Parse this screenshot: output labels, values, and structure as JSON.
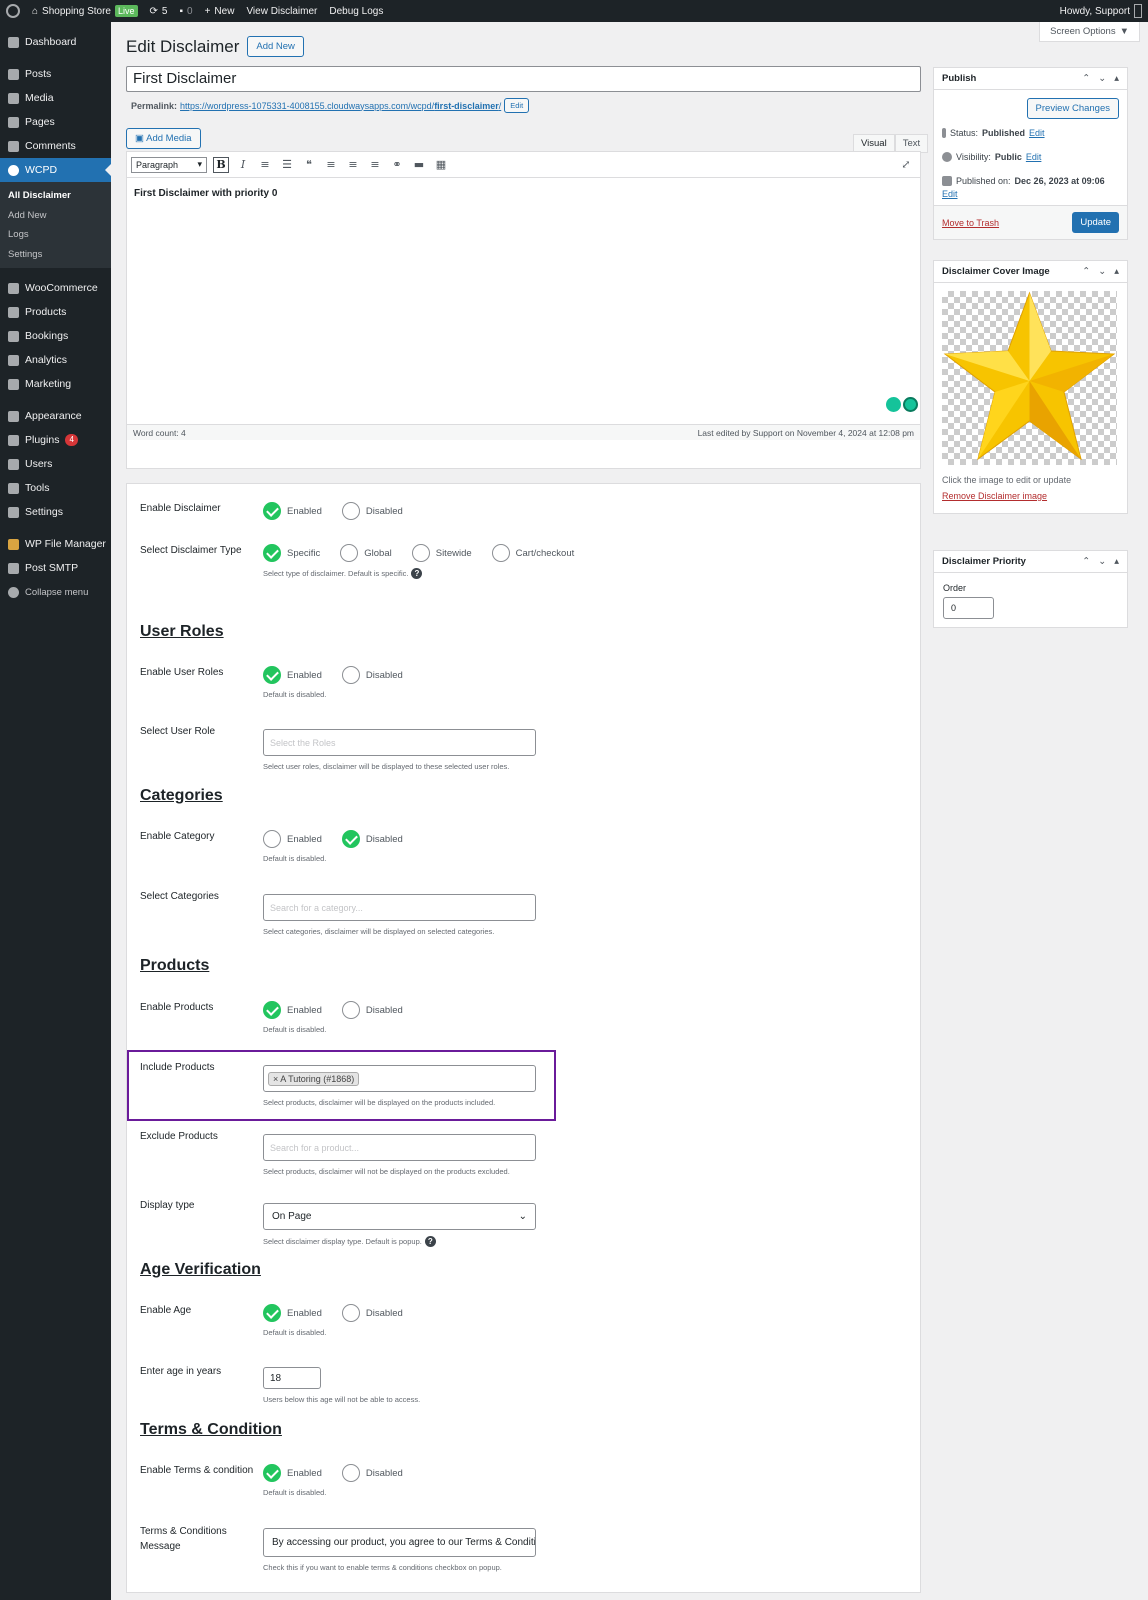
{
  "adminbar": {
    "site_name": "Shopping Store",
    "live_badge": "Live",
    "updates_count": "5",
    "comments_count": "0",
    "new_label": "New",
    "view_label": "View Disclaimer",
    "debug_label": "Debug Logs",
    "howdy": "Howdy, Support"
  },
  "sidebar": {
    "items_top": [
      {
        "label": "Dashboard",
        "icon": "dashboard-icon"
      },
      {
        "label": "Posts",
        "icon": "posts-icon"
      },
      {
        "label": "Media",
        "icon": "media-icon"
      },
      {
        "label": "Pages",
        "icon": "pages-icon"
      },
      {
        "label": "Comments",
        "icon": "comments-icon"
      },
      {
        "label": "WCPD",
        "icon": "wcpd-icon"
      }
    ],
    "submenu": [
      "All Disclaimer",
      "Add New",
      "Logs",
      "Settings"
    ],
    "items_bottom": [
      {
        "label": "WooCommerce"
      },
      {
        "label": "Products"
      },
      {
        "label": "Bookings"
      },
      {
        "label": "Analytics"
      },
      {
        "label": "Marketing"
      },
      {
        "label": "Appearance"
      },
      {
        "label": "Plugins",
        "badge": "4"
      },
      {
        "label": "Users"
      },
      {
        "label": "Tools"
      },
      {
        "label": "Settings"
      },
      {
        "label": "WP File Manager"
      },
      {
        "label": "Post SMTP"
      },
      {
        "label": "Collapse menu"
      }
    ]
  },
  "header": {
    "screen_options": "Screen Options",
    "title": "Edit Disclaimer",
    "add_new": "Add New"
  },
  "post": {
    "title": "First Disclaimer",
    "permalink_label": "Permalink:",
    "permalink_base": "https://wordpress-1075331-4008155.cloudwaysapps.com/wcpd/",
    "permalink_slug": "first-disclaimer",
    "permalink_end": "/",
    "edit_label": "Edit"
  },
  "editor": {
    "add_media": "Add Media",
    "tab_visual": "Visual",
    "tab_text": "Text",
    "format": "Paragraph",
    "content": "First Disclaimer with priority 0",
    "word_count": "Word count: 4",
    "last_edited": "Last edited by Support on November 4, 2024 at 12:08 pm"
  },
  "settings": {
    "enable_disclaimer": {
      "label": "Enable Disclaimer",
      "opt1": "Enabled",
      "opt2": "Disabled"
    },
    "disclaimer_type": {
      "label": "Select Disclaimer Type",
      "opts": [
        "Specific",
        "Global",
        "Sitewide",
        "Cart/checkout"
      ],
      "help": "Select type of disclaimer. Default is specific."
    },
    "user_roles": {
      "heading": "User Roles",
      "enable_label": "Enable User Roles",
      "opt1": "Enabled",
      "opt2": "Disabled",
      "help": "Default is disabled.",
      "select_label": "Select User Role",
      "select_placeholder": "Select the Roles",
      "select_help": "Select user roles, disclaimer will be displayed to these selected user roles."
    },
    "categories": {
      "heading": "Categories",
      "enable_label": "Enable Category",
      "opt1": "Enabled",
      "opt2": "Disabled",
      "help": "Default is disabled.",
      "select_label": "Select Categories",
      "select_placeholder": "Search for a category...",
      "select_help": "Select categories, disclaimer will be displayed on selected categories."
    },
    "products": {
      "heading": "Products",
      "enable_label": "Enable Products",
      "opt1": "Enabled",
      "opt2": "Disabled",
      "help": "Default is disabled.",
      "include_label": "Include Products",
      "include_chip": "× A Tutoring (#1868)",
      "include_help": "Select products, disclaimer will be displayed on the products included.",
      "exclude_label": "Exclude Products",
      "exclude_placeholder": "Search for a product...",
      "exclude_help": "Select products, disclaimer will not be displayed on the products excluded.",
      "display_label": "Display type",
      "display_value": "On Page",
      "display_help": "Select disclaimer display type. Default is popup."
    },
    "age": {
      "heading": "Age Verification",
      "enable_label": "Enable Age",
      "opt1": "Enabled",
      "opt2": "Disabled",
      "help": "Default is disabled.",
      "years_label": "Enter age in years",
      "years_value": "18",
      "years_help": "Users below this age will not be able to access."
    },
    "terms": {
      "heading": "Terms & Condition",
      "enable_label": "Enable Terms & condition",
      "opt1": "Enabled",
      "opt2": "Disabled",
      "help": "Default is disabled.",
      "msg_label": "Terms & Conditions Message",
      "msg_value": "By accessing our product, you agree to our Terms & Conditic",
      "msg_help": "Check this if you want to enable terms & conditions checkbox on popup."
    }
  },
  "publish": {
    "title": "Publish",
    "preview": "Preview Changes",
    "status_label": "Status:",
    "status_value": "Published",
    "visibility_label": "Visibility:",
    "visibility_value": "Public",
    "published_label": "Published on:",
    "published_value": "Dec 26, 2023 at 09:06",
    "edit": "Edit",
    "trash": "Move to Trash",
    "update": "Update"
  },
  "cover": {
    "title": "Disclaimer Cover Image",
    "caption": "Click the image to edit or update",
    "remove": "Remove Disclaimer image"
  },
  "priority": {
    "title": "Disclaimer Priority",
    "order_label": "Order",
    "order_value": "0"
  },
  "colors": {
    "accent": "#2271b1",
    "sidebar": "#1d2327",
    "check": "#22c55e",
    "highlight": "#6a1b9a"
  }
}
